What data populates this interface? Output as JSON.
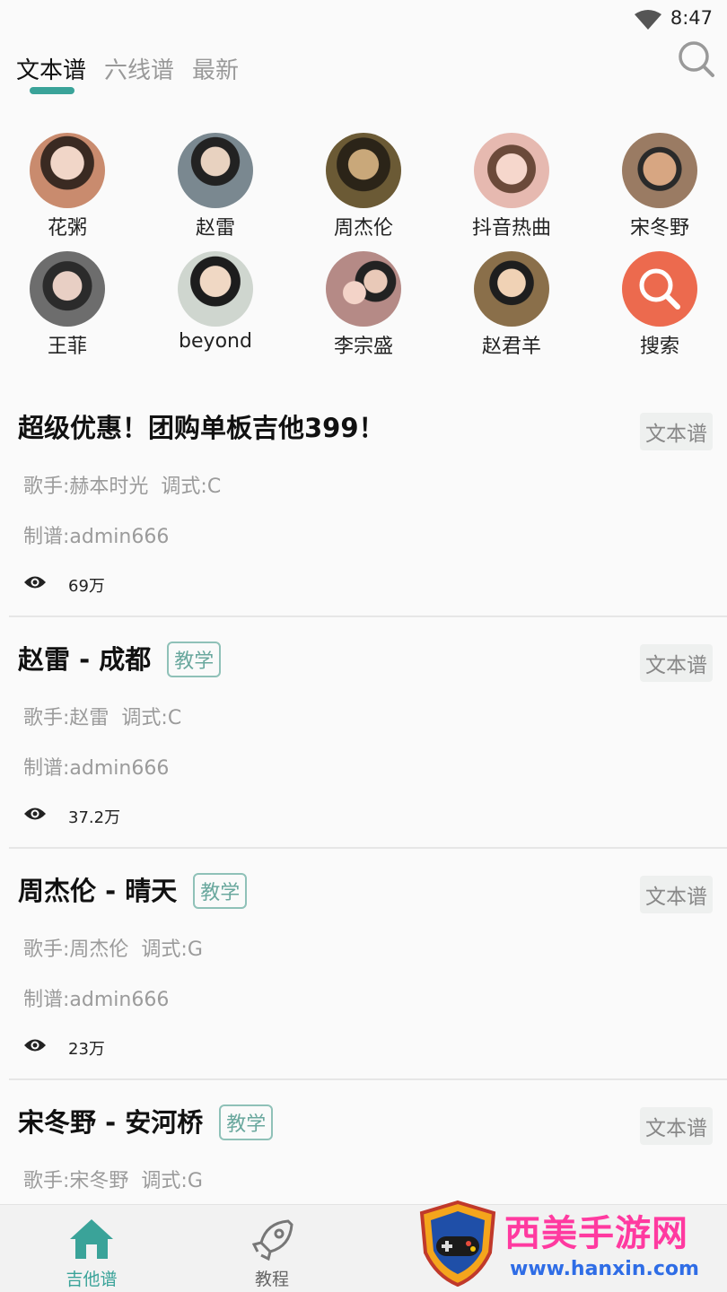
{
  "status": {
    "time": "8:47"
  },
  "tabs": [
    {
      "label": "文本谱",
      "active": true
    },
    {
      "label": "六线谱",
      "active": false
    },
    {
      "label": "最新",
      "active": false
    }
  ],
  "artists": [
    {
      "name": "花粥",
      "color": "#c98b6e"
    },
    {
      "name": "赵雷",
      "color": "#7a8890"
    },
    {
      "name": "周杰伦",
      "color": "#6b5a35"
    },
    {
      "name": "抖音热曲",
      "color": "#e6b9b0"
    },
    {
      "name": "宋冬野",
      "color": "#9a7b63"
    },
    {
      "name": "王菲",
      "color": "#6d6d6d"
    },
    {
      "name": "beyond",
      "color": "#cfd6cf"
    },
    {
      "name": "李宗盛",
      "color": "#b58a86"
    },
    {
      "name": "赵君羊",
      "color": "#8a6f4a"
    },
    {
      "name": "搜索",
      "color": "#ec6a4e",
      "icon": "search-icon"
    }
  ],
  "songs": [
    {
      "title": "超级优惠！团购单板吉他399！",
      "badge": "",
      "type": "文本谱",
      "singer": "歌手:赫本时光",
      "key": "调式:C",
      "author": "制谱:admin666",
      "views": "69万"
    },
    {
      "title": "赵雷 - 成都",
      "badge": "教学",
      "type": "文本谱",
      "singer": "歌手:赵雷",
      "key": "调式:C",
      "author": "制谱:admin666",
      "views": "37.2万"
    },
    {
      "title": "周杰伦 - 晴天",
      "badge": "教学",
      "type": "文本谱",
      "singer": "歌手:周杰伦",
      "key": "调式:G",
      "author": "制谱:admin666",
      "views": "23万"
    },
    {
      "title": "宋冬野 - 安河桥",
      "badge": "教学",
      "type": "文本谱",
      "singer": "歌手:宋冬野",
      "key": "调式:G",
      "author": "",
      "views": ""
    }
  ],
  "bottom_nav": [
    {
      "label": "吉他谱",
      "icon": "home-icon",
      "active": true
    },
    {
      "label": "教程",
      "icon": "rocket-icon",
      "active": false
    }
  ],
  "watermark": {
    "title": "西美手游网",
    "url": "www.hanxin.com"
  },
  "colors": {
    "accent": "#3aa399",
    "badge_border": "#8fc1b8",
    "search_orange": "#ec6a4e"
  }
}
